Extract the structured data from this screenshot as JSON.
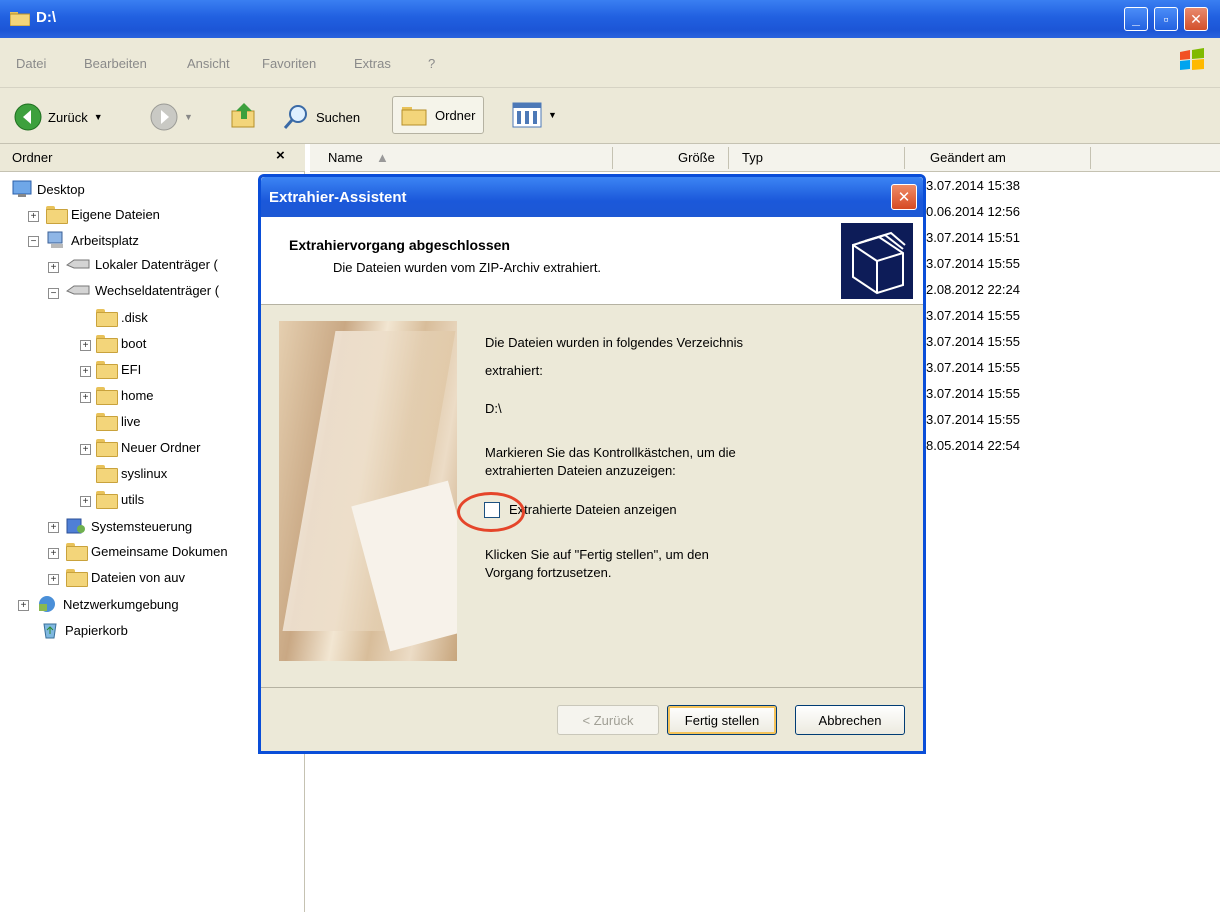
{
  "window": {
    "title": "D:\\",
    "icon": "folder-window-icon"
  },
  "menu": [
    "Datei",
    "Bearbeiten",
    "Ansicht",
    "Favoriten",
    "Extras",
    "?"
  ],
  "toolbar": {
    "back": "Zurück",
    "search": "Suchen",
    "folders": "Ordner"
  },
  "folder_pane": {
    "title": "Ordner"
  },
  "columns": {
    "name": "Name",
    "size": "Größe",
    "type": "Typ",
    "modified": "Geändert am"
  },
  "tree": {
    "desktop": "Desktop",
    "my_docs": "Eigene Dateien",
    "my_computer": "Arbeitsplatz",
    "local_disk": "Lokaler Datenträger (",
    "removable": "Wechseldatenträger (",
    "disk": ".disk",
    "boot": "boot",
    "efi": "EFI",
    "home": "home",
    "live": "live",
    "new_folder": "Neuer Ordner",
    "syslinux": "syslinux",
    "utils": "utils",
    "control_panel": "Systemsteuerung",
    "shared_docs": "Gemeinsame Dokumen",
    "auv_files": "Dateien von auv",
    "network": "Netzwerkumgebung",
    "recycle": "Papierkorb"
  },
  "dates": [
    "3.07.2014 15:38",
    "0.06.2014 12:56",
    "3.07.2014 15:51",
    "3.07.2014 15:55",
    "2.08.2012 22:24",
    "3.07.2014 15:55",
    "3.07.2014 15:55",
    "3.07.2014 15:55",
    "3.07.2014 15:55",
    "3.07.2014 15:55",
    "8.05.2014 22:54"
  ],
  "dialog": {
    "title": "Extrahier-Assistent",
    "header_title": "Extrahiervorgang abgeschlossen",
    "header_sub": "Die Dateien wurden vom ZIP-Archiv extrahiert.",
    "line1": "Die Dateien wurden in folgendes Verzeichnis",
    "line2": "extrahiert:",
    "path": "D:\\",
    "mark1": "Markieren Sie das Kontrollkästchen, um die",
    "mark2": "extrahierten Dateien anzuzeigen:",
    "checkbox_label": "Extrahierte Dateien anzeigen",
    "finish1": "Klicken Sie auf \"Fertig stellen\", um den",
    "finish2": "Vorgang fortzusetzen.",
    "back_btn": "< Zurück",
    "finish_btn": "Fertig stellen",
    "cancel_btn": "Abbrechen"
  }
}
